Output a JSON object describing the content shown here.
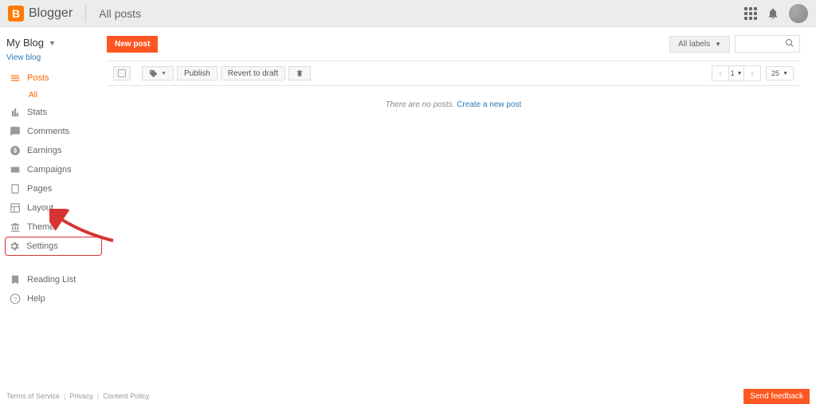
{
  "header": {
    "logo_text": "Blogger",
    "title": "All posts"
  },
  "sidebar": {
    "blog_name": "My Blog",
    "view_blog": "View blog",
    "items": {
      "posts": "Posts",
      "posts_all": "All",
      "stats": "Stats",
      "comments": "Comments",
      "earnings": "Earnings",
      "campaigns": "Campaigns",
      "pages": "Pages",
      "layout": "Layout",
      "theme": "Theme",
      "settings": "Settings",
      "reading_list": "Reading List",
      "help": "Help"
    }
  },
  "content": {
    "new_post_label": "New post",
    "labels_dropdown": "All labels",
    "toolbar": {
      "publish": "Publish",
      "revert": "Revert to draft"
    },
    "pager": {
      "current": "1",
      "page_size": "25"
    },
    "empty_text": "There are no posts.",
    "empty_link": "Create a new post"
  },
  "footer": {
    "terms": "Terms of Service",
    "privacy": "Privacy",
    "content_policy": "Content Policy",
    "feedback": "Send feedback"
  }
}
